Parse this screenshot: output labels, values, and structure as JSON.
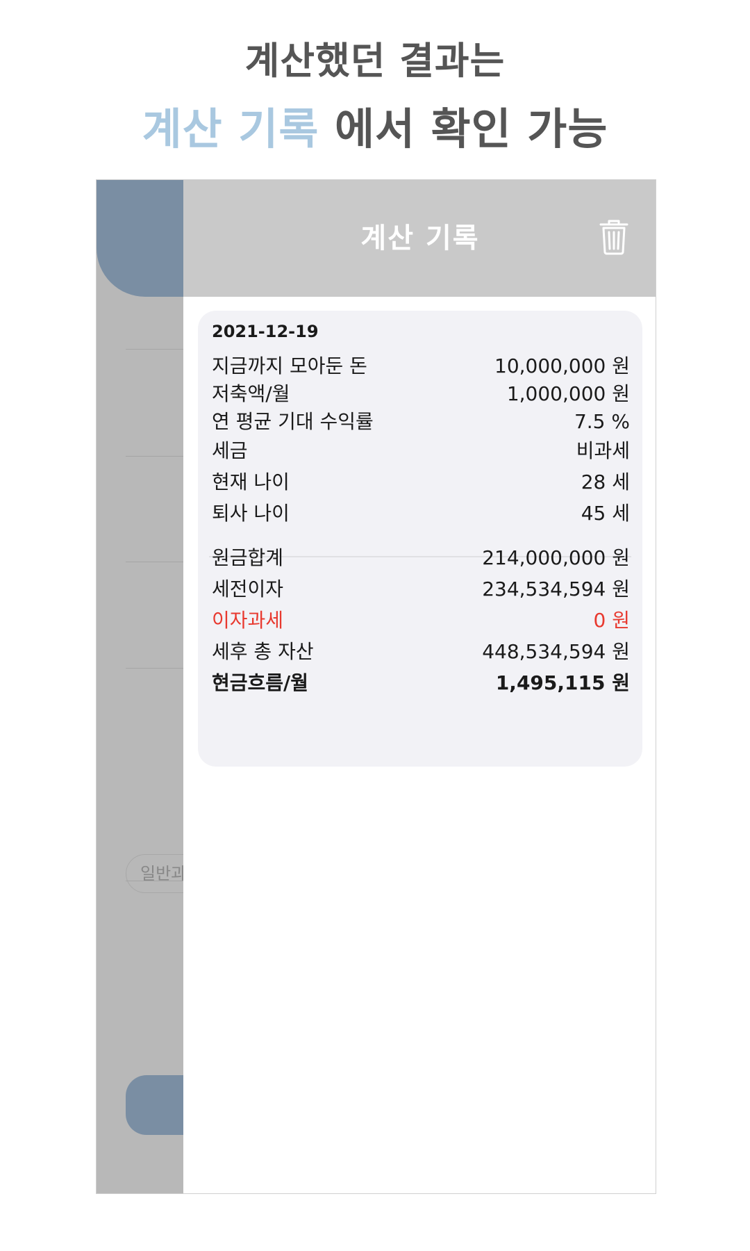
{
  "headline": {
    "line1": "계산했던 결과는",
    "line2_accent": "계산 기록",
    "line2_rest": " 에서 확인 가능"
  },
  "background_app": {
    "pill_label": "일반과"
  },
  "history": {
    "title": "계산 기록",
    "delete_icon": "trash-icon",
    "record": {
      "date": "2021-12-19",
      "inputs": [
        {
          "label": "지금까지 모아둔 돈",
          "value": "10,000,000 원"
        },
        {
          "label": "저축액/월",
          "value": "1,000,000 원"
        },
        {
          "label": "연 평균 기대 수익률",
          "value": "7.5 %"
        },
        {
          "label": "세금",
          "value": "비과세"
        },
        {
          "label": "현재 나이",
          "value": "28 세"
        },
        {
          "label": "퇴사 나이",
          "value": "45 세"
        }
      ],
      "results": [
        {
          "label": "원금합계",
          "value": "214,000,000 원"
        },
        {
          "label": "세전이자",
          "value": "234,534,594 원"
        },
        {
          "label": "이자과세",
          "value": "0 원"
        },
        {
          "label": "세후 총 자산",
          "value": "448,534,594 원"
        },
        {
          "label": "현금흐름/월",
          "value": "1,495,115 원"
        }
      ]
    }
  },
  "colors": {
    "accent": "#a9c8e0",
    "header_gray": "#c9c9c9",
    "slate": "#7a8ea3",
    "tax_red": "#e8392f",
    "card_bg": "#f2f2f6"
  }
}
